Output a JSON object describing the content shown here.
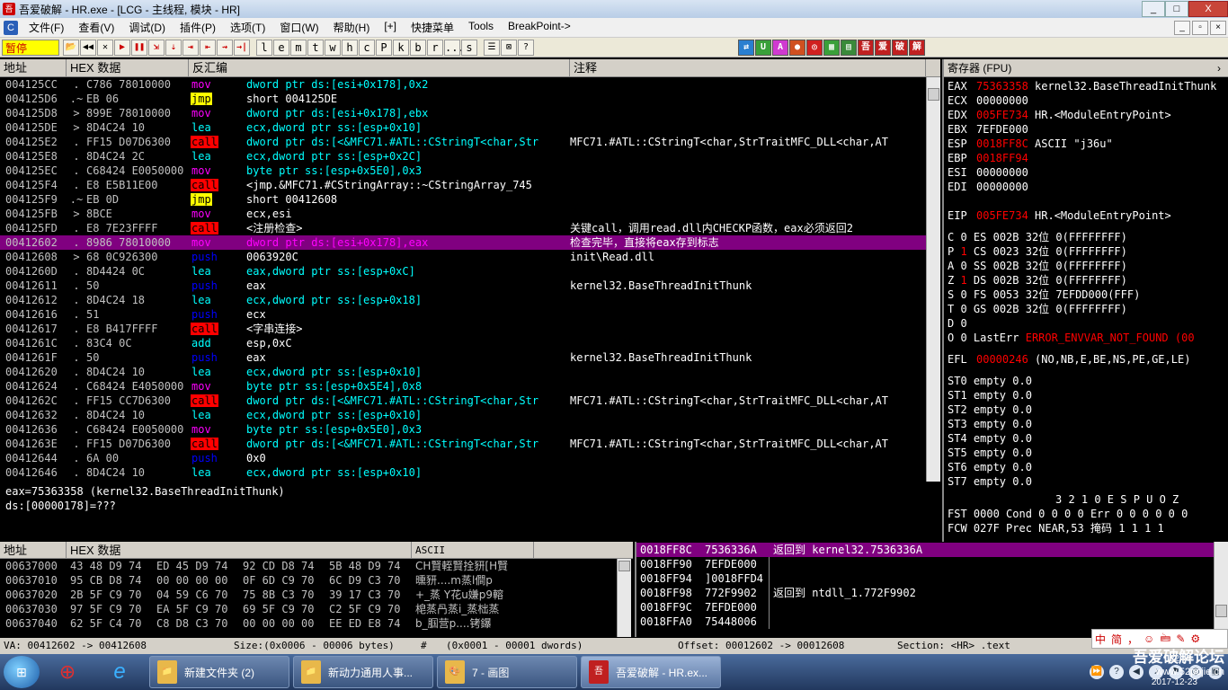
{
  "window": {
    "title": "吾爱破解 - HR.exe - [LCG - 主线程, 模块 - HR]",
    "app_icon_label": "吾",
    "btn_min": "_",
    "btn_max": "□",
    "btn_close": "X"
  },
  "menu": {
    "cpu_icon": "C",
    "items": [
      "文件(F)",
      "查看(V)",
      "调试(D)",
      "插件(P)",
      "选项(T)",
      "窗口(W)",
      "帮助(H)",
      "[+]",
      "快捷菜单",
      "Tools",
      "BreakPoint->"
    ],
    "mdi_buttons": [
      "_",
      "▫",
      "×"
    ]
  },
  "toolbar": {
    "state": "暂停",
    "buttons": [
      "📂",
      "◀◀",
      "✕",
      "▶",
      "❚❚",
      "⇲",
      "⇣",
      "⇥",
      "⇤",
      "⇝",
      "→|"
    ],
    "letters": [
      "l",
      "e",
      "m",
      "t",
      "w",
      "h",
      "c",
      "P",
      "k",
      "b",
      "r",
      "...",
      "s"
    ],
    "extra": [
      "☰",
      "⊠",
      "?"
    ],
    "right_buttons": [
      {
        "label": "⇄",
        "color": "#2a7fd0"
      },
      {
        "label": "U",
        "color": "#3aa03a"
      },
      {
        "label": "A",
        "color": "#d03ad0"
      },
      {
        "label": "●",
        "color": "#d05020"
      },
      {
        "label": "◎",
        "color": "#d02020"
      },
      {
        "label": "▦",
        "color": "#3aa03a"
      },
      {
        "label": "▤",
        "color": "#3a8a3a"
      },
      {
        "label": "吾",
        "color": "#c02020"
      },
      {
        "label": "爱",
        "color": "#c02020"
      },
      {
        "label": "破",
        "color": "#c02020"
      },
      {
        "label": "解",
        "color": "#c02020"
      }
    ]
  },
  "disasm": {
    "headers": [
      "地址",
      "HEX 数据",
      "反汇编",
      "注释"
    ],
    "rows": [
      {
        "addr": "004125CC",
        "mark": ".",
        "hex": "C786 78010000",
        "op": "mov",
        "args": "dword ptr ds:[esi+0x178],0x2",
        "cmt": "",
        "mem": true
      },
      {
        "addr": "004125D6",
        "mark": ".~",
        "hex": "EB 06",
        "op": "jmp",
        "args": "short 004125DE",
        "cmt": "",
        "mem": false
      },
      {
        "addr": "004125D8",
        "mark": ">",
        "hex": "899E 78010000",
        "op": "mov",
        "args": "dword ptr ds:[esi+0x178],ebx",
        "cmt": "",
        "mem": true
      },
      {
        "addr": "004125DE",
        "mark": ">",
        "hex": "8D4C24 10",
        "op": "lea",
        "args": "ecx,dword ptr ss:[esp+0x10]",
        "cmt": "",
        "mem": true
      },
      {
        "addr": "004125E2",
        "mark": ".",
        "hex": "FF15 D07D6300",
        "op": "call",
        "args": "dword ptr ds:[<&MFC71.#ATL::CStringT<char,Str",
        "cmt": "MFC71.#ATL::CStringT<char,StrTraitMFC_DLL<char,AT",
        "mem": true
      },
      {
        "addr": "004125E8",
        "mark": ".",
        "hex": "8D4C24 2C",
        "op": "lea",
        "args": "ecx,dword ptr ss:[esp+0x2C]",
        "cmt": "",
        "mem": true
      },
      {
        "addr": "004125EC",
        "mark": ".",
        "hex": "C68424 E0050000",
        "op": "mov",
        "args": "byte ptr ss:[esp+0x5E0],0x3",
        "cmt": "",
        "mem": true
      },
      {
        "addr": "004125F4",
        "mark": ".",
        "hex": "E8 E5B11E00",
        "op": "call",
        "args": "<jmp.&MFC71.#CStringArray::~CStringArray_745",
        "cmt": "",
        "mem": false
      },
      {
        "addr": "004125F9",
        "mark": ".~",
        "hex": "EB 0D",
        "op": "jmp",
        "args": "short 00412608",
        "cmt": "",
        "mem": false
      },
      {
        "addr": "004125FB",
        "mark": ">",
        "hex": "8BCE",
        "op": "mov",
        "args": "ecx,esi",
        "cmt": "",
        "mem": false
      },
      {
        "addr": "004125FD",
        "mark": ".",
        "hex": "E8 7E23FFFF",
        "op": "call",
        "args": "<注册检查>",
        "cmt": "关键call，调用read.dll内CHECKP函数，eax必须返回2",
        "mem": false
      },
      {
        "addr": "00412602",
        "mark": ".",
        "hex": "8986 78010000",
        "op": "mov",
        "args": "dword ptr ds:[esi+0x178],eax",
        "cmt": "检查完毕，直接将eax存到标志",
        "mem": true,
        "selected": true
      },
      {
        "addr": "00412608",
        "mark": ">",
        "hex": "68 0C926300",
        "op": "push",
        "args": "0063920C",
        "cmt": "init\\Read.dll",
        "mem": false
      },
      {
        "addr": "0041260D",
        "mark": ".",
        "hex": "8D4424 0C",
        "op": "lea",
        "args": "eax,dword ptr ss:[esp+0xC]",
        "cmt": "",
        "mem": true
      },
      {
        "addr": "00412611",
        "mark": ".",
        "hex": "50",
        "op": "push",
        "args": "eax",
        "cmt": "kernel32.BaseThreadInitThunk",
        "mem": false
      },
      {
        "addr": "00412612",
        "mark": ".",
        "hex": "8D4C24 18",
        "op": "lea",
        "args": "ecx,dword ptr ss:[esp+0x18]",
        "cmt": "",
        "mem": true
      },
      {
        "addr": "00412616",
        "mark": ".",
        "hex": "51",
        "op": "push",
        "args": "ecx",
        "cmt": "",
        "mem": false
      },
      {
        "addr": "00412617",
        "mark": ".",
        "hex": "E8 B417FFFF",
        "op": "call",
        "args": "<字串连接>",
        "cmt": "",
        "mem": false
      },
      {
        "addr": "0041261C",
        "mark": ".",
        "hex": "83C4 0C",
        "op": "add",
        "args": "esp,0xC",
        "cmt": "",
        "mem": false
      },
      {
        "addr": "0041261F",
        "mark": ".",
        "hex": "50",
        "op": "push",
        "args": "eax",
        "cmt": "kernel32.BaseThreadInitThunk",
        "mem": false
      },
      {
        "addr": "00412620",
        "mark": ".",
        "hex": "8D4C24 10",
        "op": "lea",
        "args": "ecx,dword ptr ss:[esp+0x10]",
        "cmt": "",
        "mem": true
      },
      {
        "addr": "00412624",
        "mark": ".",
        "hex": "C68424 E4050000",
        "op": "mov",
        "args": "byte ptr ss:[esp+0x5E4],0x8",
        "cmt": "",
        "mem": true
      },
      {
        "addr": "0041262C",
        "mark": ".",
        "hex": "FF15 CC7D6300",
        "op": "call",
        "args": "dword ptr ds:[<&MFC71.#ATL::CStringT<char,Str",
        "cmt": "MFC71.#ATL::CStringT<char,StrTraitMFC_DLL<char,AT",
        "mem": true
      },
      {
        "addr": "00412632",
        "mark": ".",
        "hex": "8D4C24 10",
        "op": "lea",
        "args": "ecx,dword ptr ss:[esp+0x10]",
        "cmt": "",
        "mem": true
      },
      {
        "addr": "00412636",
        "mark": ".",
        "hex": "C68424 E0050000",
        "op": "mov",
        "args": "byte ptr ss:[esp+0x5E0],0x3",
        "cmt": "",
        "mem": true
      },
      {
        "addr": "0041263E",
        "mark": ".",
        "hex": "FF15 D07D6300",
        "op": "call",
        "args": "dword ptr ds:[<&MFC71.#ATL::CStringT<char,Str",
        "cmt": "MFC71.#ATL::CStringT<char,StrTraitMFC_DLL<char,AT",
        "mem": true
      },
      {
        "addr": "00412644",
        "mark": ".",
        "hex": "6A 00",
        "op": "push",
        "args": "0x0",
        "cmt": "",
        "mem": false
      },
      {
        "addr": "00412646",
        "mark": ".",
        "hex": "8D4C24 10",
        "op": "lea",
        "args": "ecx,dword ptr ss:[esp+0x10]",
        "cmt": "",
        "mem": true
      }
    ]
  },
  "info": {
    "line1": "eax=75363358 (kernel32.BaseThreadInitThunk)",
    "line2": "ds:[00000178]=???"
  },
  "registers": {
    "header": "寄存器 (FPU)",
    "gp": [
      {
        "name": "EAX",
        "value": "75363358",
        "desc": "kernel32.BaseThreadInitThunk",
        "changed": true
      },
      {
        "name": "ECX",
        "value": "00000000",
        "desc": "",
        "changed": false
      },
      {
        "name": "EDX",
        "value": "005FE734",
        "desc": "HR.<ModuleEntryPoint>",
        "changed": true
      },
      {
        "name": "EBX",
        "value": "7EFDE000",
        "desc": "",
        "changed": false
      },
      {
        "name": "ESP",
        "value": "0018FF8C",
        "desc": "ASCII \"j36u\"",
        "changed": true
      },
      {
        "name": "EBP",
        "value": "0018FF94",
        "desc": "",
        "changed": true
      },
      {
        "name": "ESI",
        "value": "00000000",
        "desc": "",
        "changed": false
      },
      {
        "name": "EDI",
        "value": "00000000",
        "desc": "",
        "changed": false
      }
    ],
    "eip": {
      "name": "EIP",
      "value": "005FE734",
      "desc": "HR.<ModuleEntryPoint>"
    },
    "seg": [
      {
        "flag": "C",
        "fv": "0",
        "seg": "ES",
        "sv": "002B",
        "bits": "32位",
        "base": "0(FFFFFFFF)",
        "fchg": false
      },
      {
        "flag": "P",
        "fv": "1",
        "seg": "CS",
        "sv": "0023",
        "bits": "32位",
        "base": "0(FFFFFFFF)",
        "fchg": true
      },
      {
        "flag": "A",
        "fv": "0",
        "seg": "SS",
        "sv": "002B",
        "bits": "32位",
        "base": "0(FFFFFFFF)",
        "fchg": false
      },
      {
        "flag": "Z",
        "fv": "1",
        "seg": "DS",
        "sv": "002B",
        "bits": "32位",
        "base": "0(FFFFFFFF)",
        "fchg": true
      },
      {
        "flag": "S",
        "fv": "0",
        "seg": "FS",
        "sv": "0053",
        "bits": "32位",
        "base": "7EFDD000(FFF)",
        "fchg": false
      },
      {
        "flag": "T",
        "fv": "0",
        "seg": "GS",
        "sv": "002B",
        "bits": "32位",
        "base": "0(FFFFFFFF)",
        "fchg": false
      }
    ],
    "d_flag": {
      "flag": "D",
      "fv": "0"
    },
    "o_flag": {
      "flag": "O",
      "fv": "0",
      "label": "LastErr",
      "value": "ERROR_ENVVAR_NOT_FOUND (00"
    },
    "efl": {
      "name": "EFL",
      "value": "00000246",
      "desc": "(NO,NB,E,BE,NS,PE,GE,LE)"
    },
    "st": [
      "ST0 empty 0.0",
      "ST1 empty 0.0",
      "ST2 empty 0.0",
      "ST3 empty 0.0",
      "ST4 empty 0.0",
      "ST5 empty 0.0",
      "ST6 empty 0.0",
      "ST7 empty 0.0"
    ],
    "fpu_hdr": "3 2 1 0      E S P U O Z",
    "fst": "FST 0000  Cond 0 0 0 0  Err 0 0 0 0 0 0",
    "fcw_a": "FCW 027F  Prec NEAR,53",
    "fcw_b": "掩码",
    "fcw_c": "1 1 1 1"
  },
  "dump": {
    "headers": [
      "地址",
      "HEX 数据",
      "ASCII"
    ],
    "rows": [
      {
        "addr": "00637000",
        "h": [
          "43 48 D9 74",
          "ED 45 D9 74",
          "92 CD D8 74",
          "5B 48 D9 74"
        ],
        "asc": "CH賢輊賢拴豜[H賢"
      },
      {
        "addr": "00637010",
        "h": [
          "95 CB D8 74",
          "00 00 00 00",
          "0F 6D C9 70",
          "6C D9 C3 70"
        ],
        "asc": "曛豜....m蒸l僴p"
      },
      {
        "addr": "00637020",
        "h": [
          "2B 5F C9 70",
          "04 59 C6 70",
          "75 8B C3 70",
          "39 17 C3 70"
        ],
        "asc": "+_蒸 Y花u嫌p9䡥"
      },
      {
        "addr": "00637030",
        "h": [
          "97 5F C9 70",
          "EA 5F C9 70",
          "69 5F C9 70",
          "C2 5F C9 70"
        ],
        "asc": "梍蒸冎蒸i_蒸柮蒸"
      },
      {
        "addr": "00637040",
        "h": [
          "62 5F C4 70",
          "C8 D8 C3 70",
          "00 00 00 00",
          "EE ED E8 74"
        ],
        "asc": "b_腘营p....铐鑤"
      }
    ]
  },
  "stack": {
    "rows": [
      {
        "addr": "0018FF8C",
        "val": "7536336A",
        "cmt": "返回到 kernel32.7536336A",
        "selected": true
      },
      {
        "addr": "0018FF90",
        "val": "7EFDE000",
        "cmt": ""
      },
      {
        "addr": "0018FF94",
        "val": "]0018FFD4",
        "cmt": ""
      },
      {
        "addr": "0018FF98",
        "val": "772F9902",
        "cmt": "返回到 ntdll_1.772F9902"
      },
      {
        "addr": "0018FF9C",
        "val": "7EFDE000",
        "cmt": ""
      },
      {
        "addr": "0018FFA0",
        "val": "75448006",
        "cmt": ""
      }
    ]
  },
  "statusbar": {
    "va": "VA: 00412602 -> 00412608",
    "size": "Size:(0x0006 - 00006 bytes)",
    "hash": "#",
    "dwords": "(0x0001 - 00001 dwords)",
    "offset": "Offset: 00012602 -> 00012608",
    "section": "Section: <HR> .text"
  },
  "taskbar": {
    "start": "⊞",
    "quick": [
      "⊕",
      "e"
    ],
    "tasks": [
      {
        "label": "新建文件夹 (2)",
        "icon": "📁",
        "active": false
      },
      {
        "label": "新动力通用人事...",
        "icon": "📁",
        "active": false
      },
      {
        "label": "7 - 画图",
        "icon": "🎨",
        "active": false
      },
      {
        "label": "吾爱破解 - HR.ex...",
        "icon": "吾",
        "active": true
      }
    ],
    "tray_icons": [
      "⏩",
      "?",
      "◀",
      "♪",
      "⚑",
      "◎",
      "▣"
    ]
  },
  "ime": {
    "items": [
      "中",
      "简",
      "，",
      "☺",
      "🖮",
      "✎",
      "⚙"
    ]
  },
  "watermark": {
    "line1": "吾爱破解论坛",
    "line2": "www.52pojie.cn",
    "time": "22:49",
    "date": "2017-12-23"
  }
}
